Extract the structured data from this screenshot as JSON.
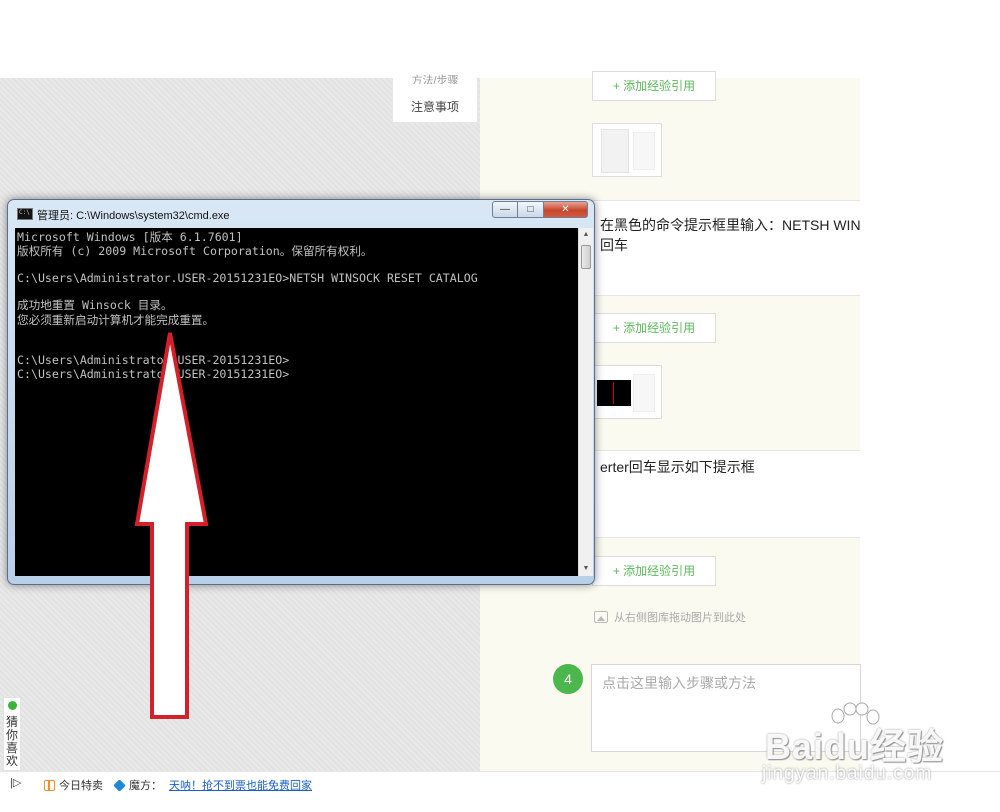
{
  "sidebar_nav": {
    "step_partial": "方法/步骤",
    "notes": "注意事项"
  },
  "steps": {
    "add_ref_label": "+ 添加经验引用",
    "step3_text_line1": "在黑色的命令提示框里输入：NETSH WIN",
    "step3_text_line2": "回车",
    "step3b_text": "erter回车显示如下提示框",
    "drag_hint": "从右侧图库拖动图片到此处",
    "step4_number": "4",
    "step4_placeholder": "点击这里输入步骤或方法"
  },
  "cmd": {
    "title": "管理员: C:\\Windows\\system32\\cmd.exe",
    "buttons": {
      "minimize": "—",
      "maximize": "□",
      "close": "✕"
    },
    "lines": [
      "Microsoft Windows [版本 6.1.7601]",
      "版权所有 (c) 2009 Microsoft Corporation。保留所有权利。",
      "",
      "C:\\Users\\Administrator.USER-20151231EO>NETSH WINSOCK RESET CATALOG",
      "",
      "成功地重置 Winsock 目录。",
      "您必须重新启动计算机才能完成重置。",
      "",
      "",
      "C:\\Users\\Administrator.USER-20151231EO>",
      "C:\\Users\\Administrator.USER-20151231EO>"
    ]
  },
  "like_tab": {
    "label": "猜你喜欢"
  },
  "bottom_bar": {
    "toggle": "|▷",
    "today_sale": "今日特卖",
    "mofang": "魔方：",
    "promo_link": "天呐！抢不到票也能免费回家"
  },
  "watermark": {
    "brand": "Baidu经验",
    "url": "jingyan.baidu.com"
  },
  "colors": {
    "accent_green": "#4cb74c",
    "arrow_red": "#d4202a",
    "link_blue": "#1a5fcc"
  }
}
